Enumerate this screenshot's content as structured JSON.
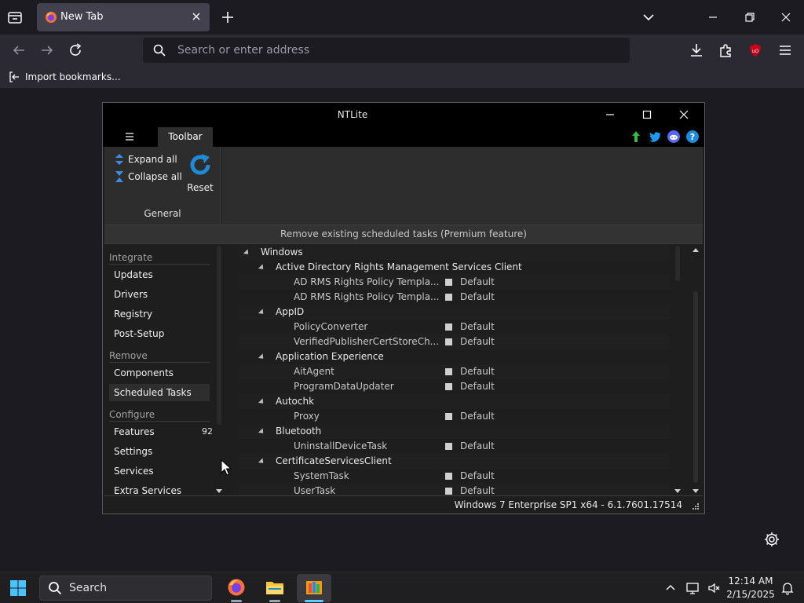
{
  "browser": {
    "tab_title": "New Tab",
    "address_placeholder": "Search or enter address",
    "bookmark_item": "Import bookmarks..."
  },
  "ntlite": {
    "window_title": "NTLite",
    "ribbon_tab": "Toolbar",
    "ribbon": {
      "expand_all": "Expand all",
      "collapse_all": "Collapse all",
      "reset": "Reset",
      "group_name": "General"
    },
    "banner": "Remove existing scheduled tasks (Premium feature)",
    "nav": {
      "integrate": {
        "title": "Integrate",
        "items": [
          "Updates",
          "Drivers",
          "Registry",
          "Post-Setup"
        ]
      },
      "remove": {
        "title": "Remove",
        "items": [
          "Components",
          "Scheduled Tasks"
        ]
      },
      "configure": {
        "title": "Configure",
        "items": [
          "Features",
          "Settings",
          "Services",
          "Extra Services"
        ]
      },
      "features_badge": "92",
      "selected": "Scheduled Tasks"
    },
    "tree": [
      {
        "label": "Windows",
        "level": 0,
        "kind": "group"
      },
      {
        "label": "Active Directory Rights Management Services Client",
        "level": 1,
        "kind": "group"
      },
      {
        "label": "AD RMS Rights Policy Templa...",
        "level": 2,
        "kind": "leaf",
        "value": "Default"
      },
      {
        "label": "AD RMS Rights Policy Templa...",
        "level": 2,
        "kind": "leaf",
        "value": "Default"
      },
      {
        "label": "AppID",
        "level": 1,
        "kind": "group"
      },
      {
        "label": "PolicyConverter",
        "level": 2,
        "kind": "leaf",
        "value": "Default"
      },
      {
        "label": "VerifiedPublisherCertStoreCh...",
        "level": 2,
        "kind": "leaf",
        "value": "Default"
      },
      {
        "label": "Application Experience",
        "level": 1,
        "kind": "group"
      },
      {
        "label": "AitAgent",
        "level": 2,
        "kind": "leaf",
        "value": "Default"
      },
      {
        "label": "ProgramDataUpdater",
        "level": 2,
        "kind": "leaf",
        "value": "Default"
      },
      {
        "label": "Autochk",
        "level": 1,
        "kind": "group"
      },
      {
        "label": "Proxy",
        "level": 2,
        "kind": "leaf",
        "value": "Default"
      },
      {
        "label": "Bluetooth",
        "level": 1,
        "kind": "group"
      },
      {
        "label": "UninstallDeviceTask",
        "level": 2,
        "kind": "leaf",
        "value": "Default"
      },
      {
        "label": "CertificateServicesClient",
        "level": 1,
        "kind": "group"
      },
      {
        "label": "SystemTask",
        "level": 2,
        "kind": "leaf",
        "value": "Default"
      },
      {
        "label": "UserTask",
        "level": 2,
        "kind": "leaf",
        "value": "Default"
      }
    ],
    "status": "Windows 7 Enterprise SP1 x64 - 6.1.7601.17514"
  },
  "taskbar": {
    "search_label": "Search",
    "time": "12:14 AM",
    "date": "2/15/2025"
  },
  "icons": {
    "tabs": "list-all-tabs-icon",
    "favicon": "firefox-icon",
    "close": "close-icon",
    "new_tab": "plus-icon",
    "overflow": "chevron-down-icon",
    "back": "arrow-left-icon",
    "forward": "arrow-right-icon",
    "reload": "reload-icon",
    "search": "search-icon",
    "downloads": "download-icon",
    "extensions": "puzzle-icon",
    "ublock": "ublock-origin-icon",
    "menu": "hamburger-menu-icon",
    "settings": "gear-icon"
  },
  "colors": {
    "browser_bg": "#1c1b22",
    "toolbar_bg": "#2b2a33",
    "ntlite_panel": "#2d2d2d",
    "accent_blue": "#1f8bd6",
    "taskbar_accent": "#60cdff",
    "update_green": "#3cb54a"
  }
}
